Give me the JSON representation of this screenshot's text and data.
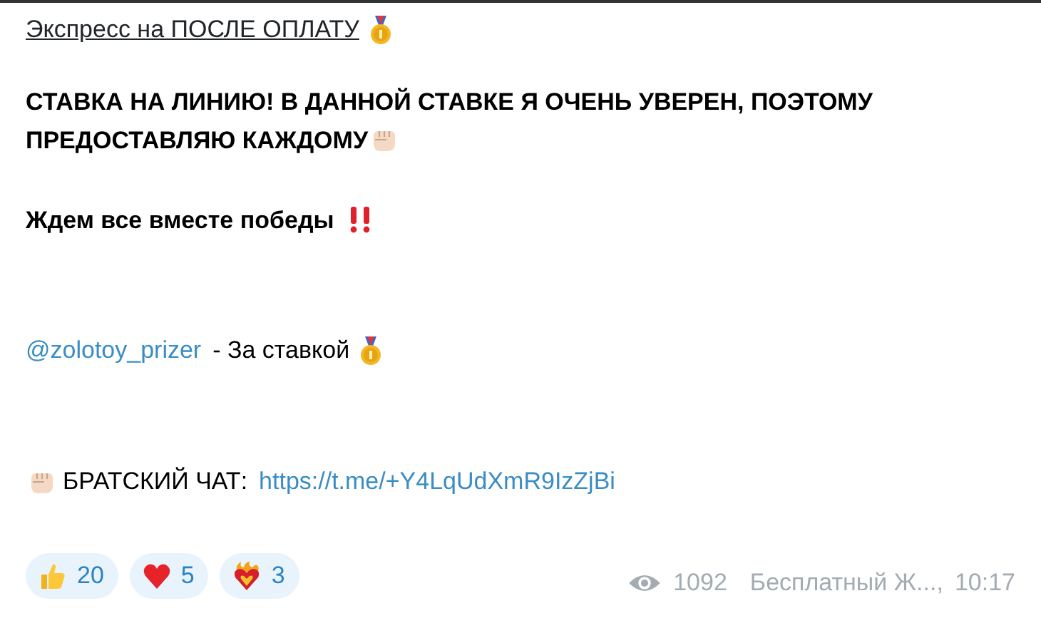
{
  "message": {
    "title": "Экспресс на ПОСЛЕ ОПЛАТУ",
    "headline": "СТАВКА НА ЛИНИЮ! В ДАННОЙ СТАВКЕ Я ОЧЕНЬ УВЕРЕН, ПОЭТОМУ ПРЕДОСТАВЛЯЮ КАЖДОМУ",
    "cheer": "Ждем все вместе победы",
    "mention": "@zolotoy_prizer",
    "mention_suffix": "- За ставкой",
    "chat_label": "БРАТСКИЙ ЧАТ:",
    "chat_link": "https://t.me/+Y4LqUdXmR9IzZjBi"
  },
  "reactions": [
    {
      "kind": "thumbs",
      "count": "20"
    },
    {
      "kind": "heart",
      "count": "5"
    },
    {
      "kind": "burning-heart",
      "count": "3"
    }
  ],
  "footer": {
    "views": "1092",
    "author": "Бесплатный Ж...,",
    "time": "10:17"
  }
}
